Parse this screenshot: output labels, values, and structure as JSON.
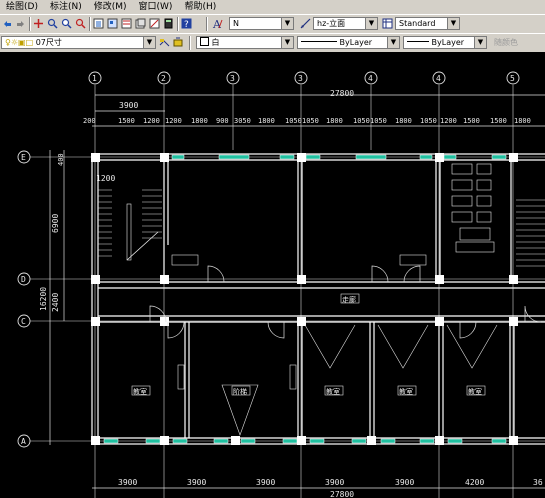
{
  "menu": [
    "绘图(D)",
    "标注(N)",
    "修改(M)",
    "窗口(W)",
    "帮助(H)"
  ],
  "toolbar1": {
    "text_style": "N",
    "dim_style": "hz-立面",
    "table_style": "Standard"
  },
  "toolbar2": {
    "layer": "07尺寸",
    "color": "白",
    "linetype": "ByLayer",
    "lineweight": "ByLayer",
    "plotstyle": "随颜色"
  },
  "drawing": {
    "total_dim": "27800",
    "top_span": "3900",
    "top_chain": [
      "200",
      "1500",
      "1200",
      "1200",
      "1800",
      "900",
      "3050",
      "1800",
      "1050",
      "1050",
      "1800",
      "1050",
      "1050",
      "1800",
      "1050",
      "1200",
      "1500",
      "1500",
      "1800"
    ],
    "bottom_chain": [
      "3900",
      "3900",
      "3900",
      "3900",
      "3900",
      "4200",
      "36"
    ],
    "bottom_total": "27800",
    "left_dims": {
      "upper": "6900",
      "middle": "2400",
      "overall": "16200",
      "top_small": "400"
    },
    "inner_dim": "1200",
    "axis_numbers": [
      "1",
      "2",
      "3",
      "3",
      "4",
      "4",
      "5"
    ],
    "axis_letters": [
      "E",
      "D",
      "C",
      "A"
    ],
    "room_labels": [
      "走廊",
      "教室",
      "阶梯",
      "教室",
      "教室",
      "教室"
    ]
  },
  "colors": {
    "ui_gray": "#d4d0c8",
    "canvas": "#000000",
    "walls": "#ffffff",
    "grid_lines": "#e0e0e0",
    "windows": "#20c0a0"
  }
}
